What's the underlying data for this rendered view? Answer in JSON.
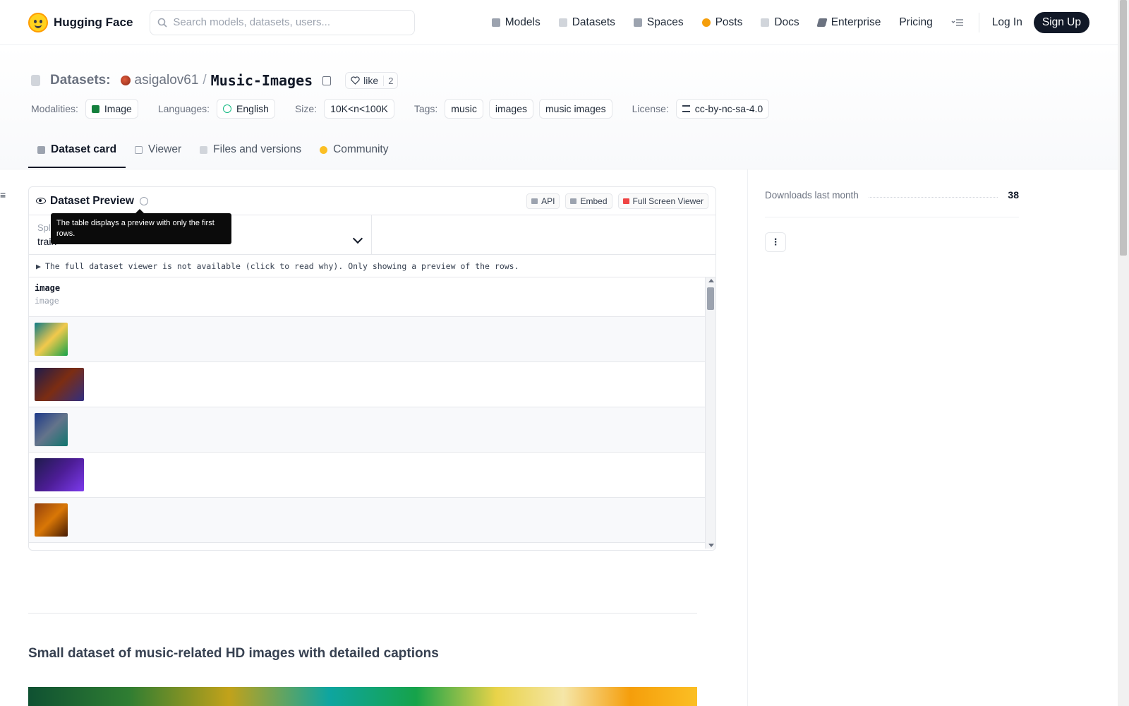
{
  "nav": {
    "brand": "Hugging Face",
    "search_placeholder": "Search models, datasets, users...",
    "links": [
      {
        "label": "Models",
        "color": "#9ca3af"
      },
      {
        "label": "Datasets",
        "color": "#d1d5db"
      },
      {
        "label": "Spaces",
        "color": "#9ca3af"
      },
      {
        "label": "Posts",
        "color": "#f59e0b"
      },
      {
        "label": "Docs",
        "color": "#d1d5db"
      },
      {
        "label": "Enterprise",
        "color": "#6b7280"
      },
      {
        "label": "Pricing",
        "color": ""
      }
    ],
    "login": "Log In",
    "signup": "Sign Up"
  },
  "header": {
    "section": "Datasets:",
    "owner": "asigalov61",
    "separator": "/",
    "repo": "Music-Images",
    "like_label": "like",
    "like_count": "2",
    "modalities_label": "Modalities:",
    "modality": "Image",
    "languages_label": "Languages:",
    "language": "English",
    "size_label": "Size:",
    "size": "10K<n<100K",
    "tags_label": "Tags:",
    "tags": [
      "music",
      "images",
      "music images"
    ],
    "license_label": "License:",
    "license": "cc-by-nc-sa-4.0"
  },
  "tabs": [
    {
      "label": "Dataset card",
      "active": true
    },
    {
      "label": "Viewer",
      "active": false
    },
    {
      "label": "Files and versions",
      "active": false
    },
    {
      "label": "Community",
      "active": false
    }
  ],
  "preview": {
    "title": "Dataset Preview",
    "api": "API",
    "embed": "Embed",
    "fullscreen": "Full Screen Viewer",
    "split_label": "Split",
    "split_value": "train",
    "notice": "The full dataset viewer is not available (click to read why). Only showing a preview of the rows.",
    "tooltip": "The table displays a preview with only the first rows.",
    "column": {
      "name": "image",
      "type": "image"
    },
    "rows": [
      {
        "image": "music-images-logo",
        "colors": [
          "#0e7c86",
          "#f2c94c",
          "#16a34a"
        ]
      },
      {
        "image": "concert-stage",
        "colors": [
          "#1e1b4b",
          "#7c2d12",
          "#312e81"
        ]
      },
      {
        "image": "crowd-musicians",
        "colors": [
          "#1e3a8a",
          "#64748b",
          "#0f766e"
        ]
      },
      {
        "image": "band-purple-stage",
        "colors": [
          "#1e1b4b",
          "#4c1d95",
          "#7c3aed"
        ]
      },
      {
        "image": "acoustic-guitar",
        "colors": [
          "#92400e",
          "#d97706",
          "#451a03"
        ]
      }
    ]
  },
  "content": {
    "heading": "Small dataset of music-related HD images with detailed captions"
  },
  "sidebar": {
    "downloads_label": "Downloads last month",
    "downloads_count": "38",
    "more_button": "⋮"
  }
}
